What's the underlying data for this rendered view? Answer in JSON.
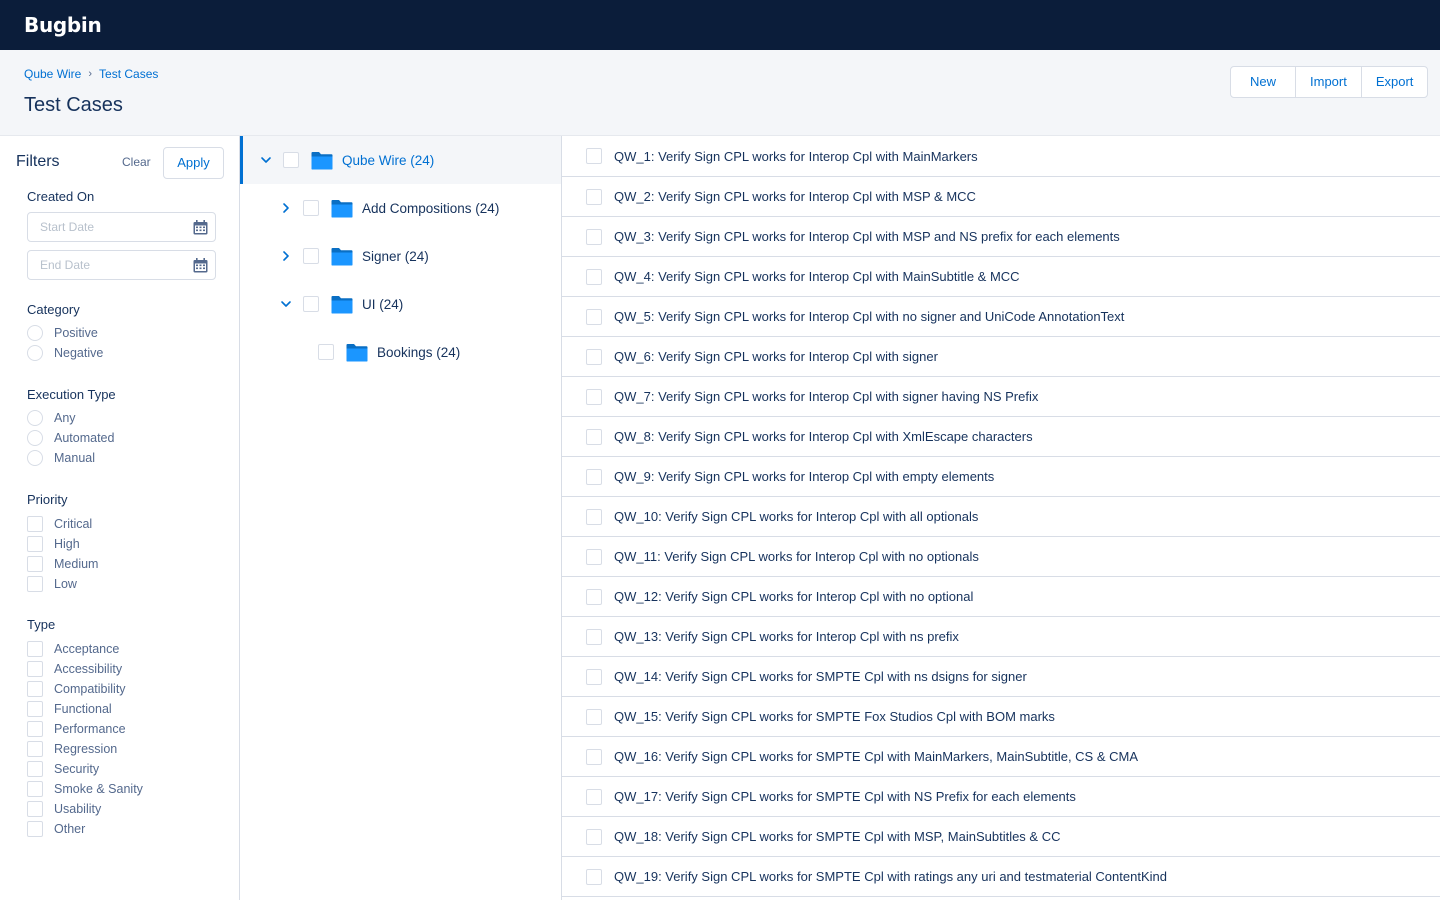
{
  "app": {
    "brand": "Bugbin"
  },
  "breadcrumb": [
    "Qube Wire",
    "Test Cases"
  ],
  "header": {
    "title": "Test Cases",
    "actions": {
      "new_label": "New",
      "import_label": "Import",
      "export_label": "Export"
    }
  },
  "filters": {
    "title": "Filters",
    "clear_label": "Clear",
    "apply_label": "Apply",
    "created_on": {
      "label": "Created On",
      "start_placeholder": "Start Date",
      "end_placeholder": "End Date"
    },
    "category": {
      "label": "Category",
      "options": [
        "Positive",
        "Negative"
      ]
    },
    "execution_type": {
      "label": "Execution Type",
      "options": [
        "Any",
        "Automated",
        "Manual"
      ]
    },
    "priority": {
      "label": "Priority",
      "options": [
        "Critical",
        "High",
        "Medium",
        "Low"
      ]
    },
    "type": {
      "label": "Type",
      "options": [
        "Acceptance",
        "Accessibility",
        "Compatibility",
        "Functional",
        "Performance",
        "Regression",
        "Security",
        "Smoke & Sanity",
        "Usability",
        "Other"
      ]
    }
  },
  "tree": {
    "nodes": [
      {
        "label": "Qube Wire (24)",
        "depth": 0,
        "expander": "expanded",
        "selected": true
      },
      {
        "label": "Add Compositions (24)",
        "depth": 1,
        "expander": "collapsed",
        "selected": false
      },
      {
        "label": "Signer (24)",
        "depth": 1,
        "expander": "collapsed",
        "selected": false
      },
      {
        "label": "UI (24)",
        "depth": 1,
        "expander": "expanded",
        "selected": false
      },
      {
        "label": "Bookings (24)",
        "depth": 2,
        "expander": "none",
        "selected": false
      }
    ],
    "folder_color": "#1b96ff",
    "folder_color_dark": "#0a6fc4"
  },
  "test_cases": [
    "QW_1: Verify Sign CPL works for Interop Cpl with MainMarkers",
    "QW_2: Verify Sign CPL works for Interop Cpl with MSP & MCC",
    "QW_3: Verify Sign CPL works for Interop Cpl with MSP and NS prefix for each elements",
    "QW_4: Verify Sign CPL works for Interop Cpl with MainSubtitle & MCC",
    "QW_5: Verify Sign CPL works for Interop Cpl with no signer and UniCode AnnotationText",
    "QW_6: Verify Sign CPL works for Interop Cpl with signer",
    "QW_7: Verify Sign CPL works for Interop Cpl with signer having NS Prefix",
    "QW_8: Verify Sign CPL works for Interop Cpl with XmlEscape characters",
    "QW_9: Verify Sign CPL works for Interop Cpl with empty elements",
    "QW_10: Verify Sign CPL works for Interop Cpl with all optionals",
    "QW_11: Verify Sign CPL works for Interop Cpl with no optionals",
    "QW_12: Verify Sign CPL works for Interop Cpl with no optional",
    "QW_13: Verify Sign CPL works for Interop Cpl with ns prefix",
    "QW_14: Verify Sign CPL works for SMPTE Cpl with ns dsigns for signer",
    "QW_15: Verify Sign CPL works for SMPTE Fox Studios Cpl with BOM marks",
    "QW_16: Verify Sign CPL works for SMPTE Cpl with MainMarkers, MainSubtitle, CS & CMA",
    "QW_17: Verify Sign CPL works for SMPTE Cpl with NS Prefix for each elements",
    "QW_18: Verify Sign CPL works for SMPTE Cpl with MSP, MainSubtitles & CC",
    "QW_19: Verify Sign CPL works for SMPTE Cpl with ratings any uri and testmaterial ContentKind"
  ],
  "colors": {
    "navbar": "#0b1d3a",
    "link": "#0070d2",
    "text": "#16325c",
    "muted": "#54698d",
    "border": "#d8dde6"
  }
}
